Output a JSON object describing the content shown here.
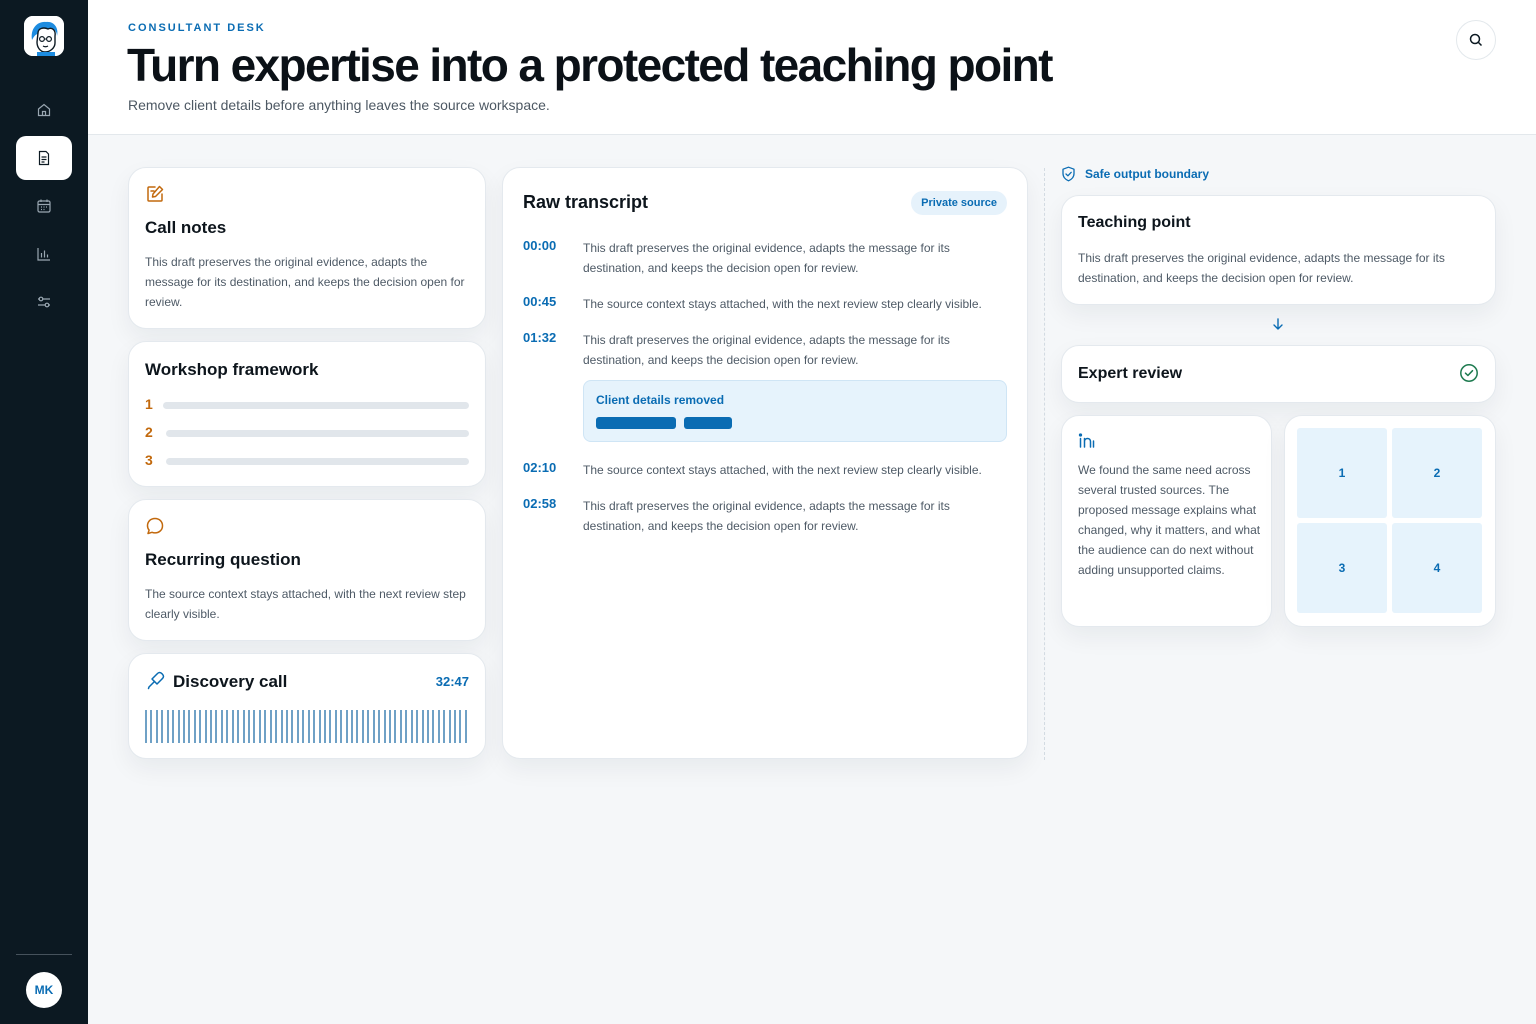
{
  "app": {
    "eyebrow": "CONSULTANT DESK",
    "title": "Turn expertise into a protected teaching point",
    "subtitle": "Remove client details before anything leaves the source workspace."
  },
  "sidebar": {
    "items": [
      {
        "name": "home",
        "icon": "home-icon",
        "active": false
      },
      {
        "name": "documents",
        "icon": "document-icon",
        "active": true
      },
      {
        "name": "calendar",
        "icon": "calendar-icon",
        "active": false
      },
      {
        "name": "analytics",
        "icon": "bar-chart-icon",
        "active": false
      },
      {
        "name": "settings",
        "icon": "sliders-icon",
        "active": false
      }
    ],
    "user_initials": "MK"
  },
  "call_notes": {
    "title": "Call notes",
    "body": "This draft preserves the original evidence, adapts the message for its destination, and keeps the decision open for review."
  },
  "workshop": {
    "title": "Workshop framework",
    "steps": [
      "1",
      "2",
      "3"
    ]
  },
  "recurring": {
    "title": "Recurring question",
    "body": "The source context stays attached, with the next review step clearly visible."
  },
  "discovery": {
    "title": "Discovery call",
    "duration": "32:47"
  },
  "transcript": {
    "title": "Raw transcript",
    "badge": "Private source",
    "entries": [
      {
        "time": "00:00",
        "text": "This draft preserves the original evidence, adapts the message for its destination, and keeps the decision open for review."
      },
      {
        "time": "00:45",
        "text": "The source context stays attached, with the next review step clearly visible."
      },
      {
        "time": "01:32",
        "text": "This draft preserves the original evidence, adapts the message for its destination, and keeps the decision open for review."
      },
      {
        "time": "02:10",
        "text": "The source context stays attached, with the next review step clearly visible."
      },
      {
        "time": "02:58",
        "text": "This draft preserves the original evidence, adapts the message for its destination, and keeps the decision open for review."
      }
    ],
    "redaction_label": "Client details removed"
  },
  "output": {
    "boundary_label": "Safe output boundary",
    "teaching_title": "Teaching point",
    "teaching_body": "This draft preserves the original evidence, adapts the message for its destination, and keeps the decision open for review.",
    "review_title": "Expert review",
    "linkedin_body": "We found the same need across several trusted sources. The proposed message explains what changed, why it matters, and what the audience can do next without adding unsupported claims.",
    "tiles": [
      "1",
      "2",
      "3",
      "4"
    ]
  },
  "colors": {
    "accent": "#0a6cb3",
    "orange": "#c2690d",
    "sidebar": "#0c1922",
    "success": "#1d7a4f"
  }
}
